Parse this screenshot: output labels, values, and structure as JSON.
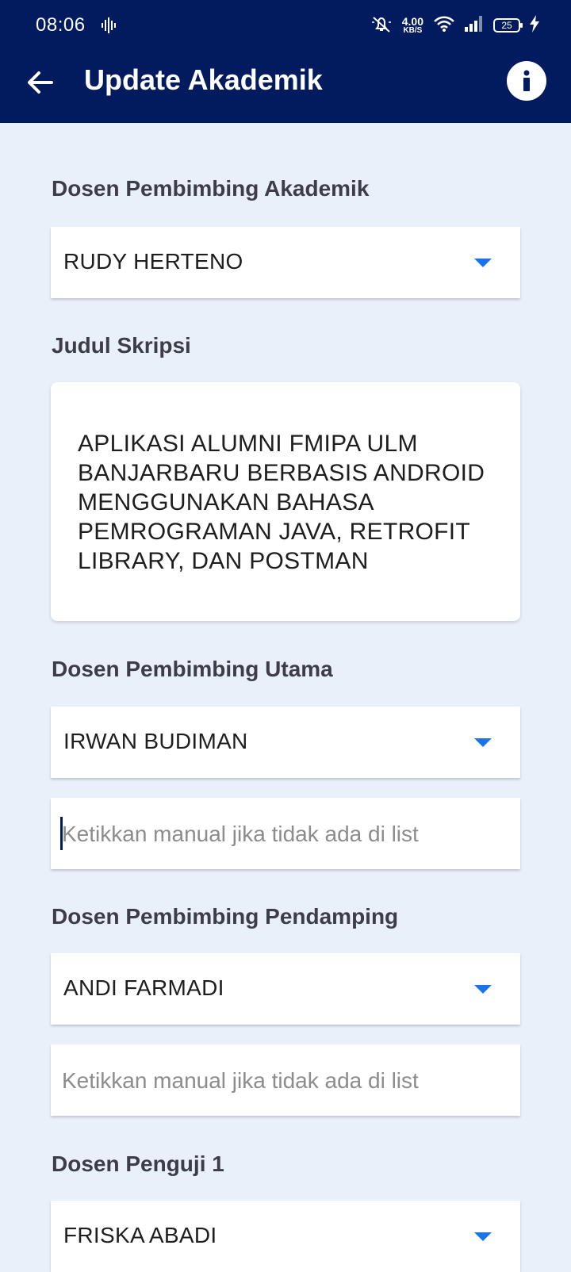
{
  "status_bar": {
    "time": "08:06",
    "net_speed_value": "4.00",
    "net_speed_unit": "KB/S",
    "battery": "25",
    "icons": [
      "voice-activity-icon",
      "mute-icon",
      "wifi-icon",
      "signal-icon",
      "battery-icon",
      "charging-icon"
    ]
  },
  "app_bar": {
    "title": "Update Akademik",
    "back_icon": "arrow-left-icon",
    "info_icon": "info-icon"
  },
  "form": {
    "pembimbing_akademik": {
      "label": "Dosen Pembimbing Akademik",
      "value": "RUDY HERTENO"
    },
    "judul_skripsi": {
      "label": "Judul Skripsi",
      "value": "APLIKASI ALUMNI FMIPA ULM BANJARBARU BERBASIS ANDROID MENGGUNAKAN BAHASA PEMROGRAMAN JAVA, RETROFIT LIBRARY, DAN POSTMAN"
    },
    "pembimbing_utama": {
      "label": "Dosen Pembimbing Utama",
      "value": "IRWAN BUDIMAN",
      "manual_placeholder": "Ketikkan manual jika tidak ada di list",
      "manual_value": ""
    },
    "pembimbing_pendamping": {
      "label": "Dosen Pembimbing Pendamping",
      "value": "ANDI FARMADI",
      "manual_placeholder": "Ketikkan manual jika tidak ada di list",
      "manual_value": ""
    },
    "penguji_1": {
      "label": "Dosen Penguji 1",
      "value": "FRISKA ABADI"
    }
  },
  "colors": {
    "primary": "#021b5e",
    "background": "#eaf0fa",
    "dropdown_arrow": "#1a73e8",
    "label": "#3d3d47"
  }
}
